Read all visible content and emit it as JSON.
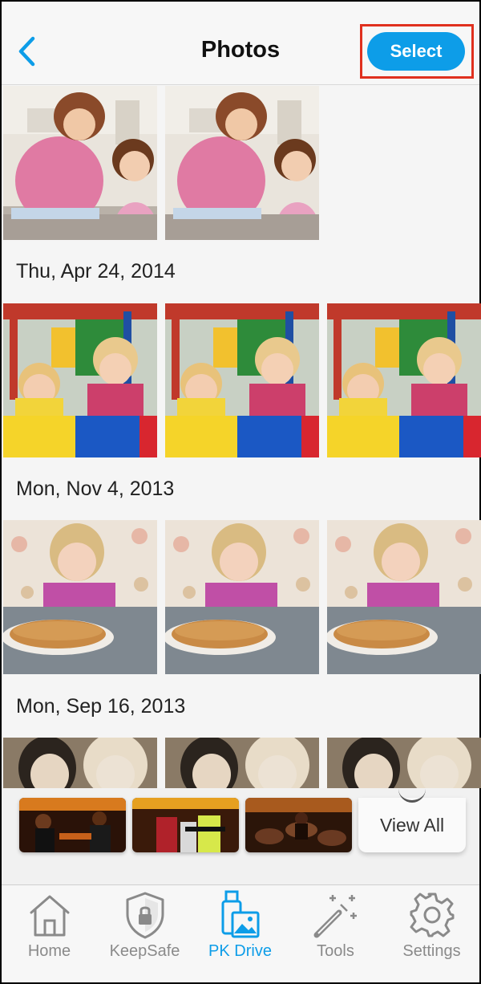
{
  "header": {
    "title": "Photos",
    "select_label": "Select"
  },
  "sections": [
    {
      "date": ""
    },
    {
      "date": "Thu, Apr 24, 2014"
    },
    {
      "date": "Mon, Nov 4, 2013"
    },
    {
      "date": "Mon, Sep 16, 2013"
    }
  ],
  "album_strip": {
    "view_all_label": "View All"
  },
  "tabbar": {
    "items": [
      {
        "label": "Home",
        "icon": "home-icon"
      },
      {
        "label": "KeepSafe",
        "icon": "shield-lock-icon"
      },
      {
        "label": "PK Drive",
        "icon": "drive-photos-icon",
        "active": true
      },
      {
        "label": "Tools",
        "icon": "magic-wand-icon"
      },
      {
        "label": "Settings",
        "icon": "gear-icon"
      }
    ]
  },
  "colors": {
    "accent": "#0d9de8",
    "highlight_frame": "#e0301e",
    "inactive_tab": "#8a8a8a"
  }
}
